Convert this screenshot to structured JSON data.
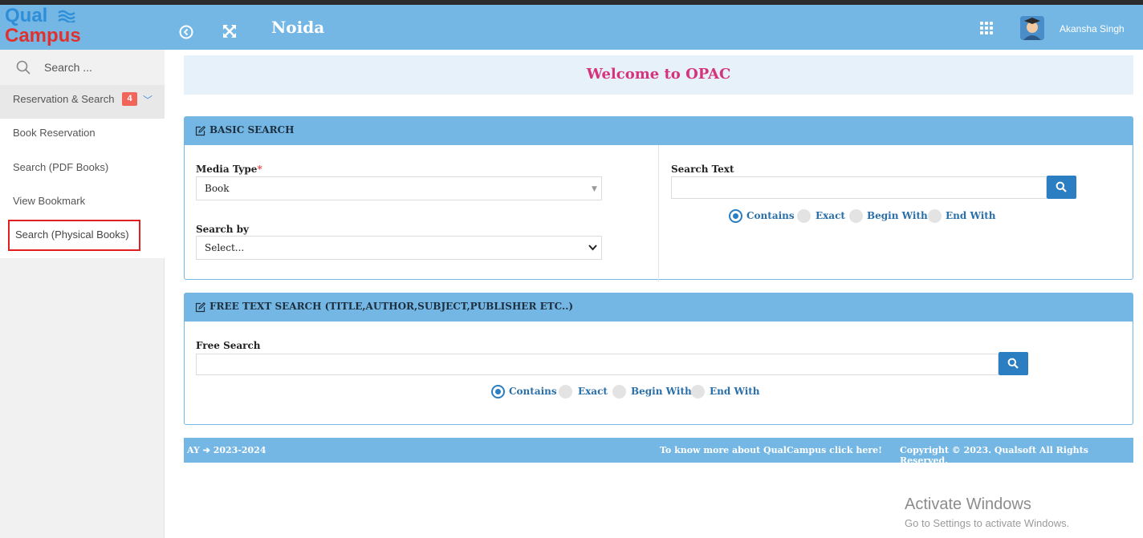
{
  "brand": {
    "line1": "Qual",
    "line2": "Campus",
    "color1": "#2e8fd8",
    "color2": "#e0312e"
  },
  "topbar": {
    "city": "Noida",
    "user_name": "Akansha Singh",
    "bg": "#74b7e4"
  },
  "sidebar": {
    "search_placeholder": "Search ...",
    "group_label": "Reservation & Search",
    "group_badge": "4",
    "items": [
      "Book Reservation",
      "Search (PDF Books)",
      "View Bookmark",
      "Search (Physical Books)"
    ]
  },
  "welcome": "Welcome to OPAC",
  "basic_search": {
    "title": "BASIC SEARCH",
    "media_type_label": "Media Type",
    "required_mark": "*",
    "media_type_value": "Book",
    "search_by_label": "Search by",
    "search_by_value": "Select...",
    "search_text_label": "Search Text",
    "options": [
      "Contains",
      "Exact",
      "Begin With",
      "End With"
    ],
    "selected": "Contains"
  },
  "free_text_search": {
    "title": "FREE TEXT SEARCH (TITLE,AUTHOR,SUBJECT,PUBLISHER ETC..)",
    "free_search_label": "Free Search",
    "options": [
      "Contains",
      "Exact",
      "Begin With",
      "End With"
    ],
    "selected": "Contains"
  },
  "footer": {
    "ay": "AY ➔ 2023-2024",
    "more": "To know more about QualCampus click here!",
    "copyright": "Copyright © 2023. Qualsoft All Rights Reserved."
  },
  "watermark": {
    "line1": "Activate Windows",
    "line2": "Go to Settings to activate Windows."
  }
}
